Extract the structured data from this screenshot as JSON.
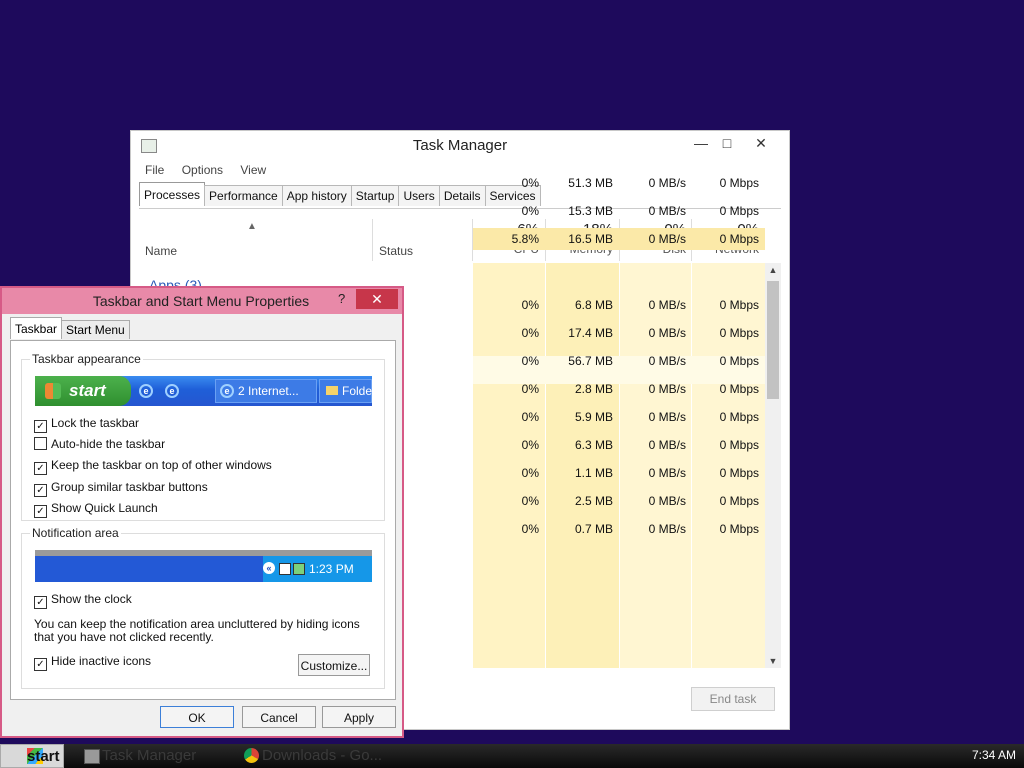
{
  "task_manager": {
    "title": "Task Manager",
    "menu": [
      "File",
      "Options",
      "View"
    ],
    "tabs": [
      "Processes",
      "Performance",
      "App history",
      "Startup",
      "Users",
      "Details",
      "Services"
    ],
    "active_tab": "Processes",
    "columns": {
      "name": "Name",
      "status": "Status",
      "cpu": {
        "pct": "6%",
        "label": "CPU"
      },
      "memory": {
        "pct": "18%",
        "label": "Memory"
      },
      "disk": {
        "pct": "0%",
        "label": "Disk"
      },
      "network": {
        "pct": "0%",
        "label": "Network"
      }
    },
    "group_label": "Apps (3)",
    "rows": [
      {
        "cpu": "0%",
        "memory": "51.3 MB",
        "disk": "0 MB/s",
        "network": "0 Mbps"
      },
      {
        "cpu": "0%",
        "memory": "15.3 MB",
        "disk": "0 MB/s",
        "network": "0 Mbps"
      },
      {
        "cpu": "5.8%",
        "memory": "16.5 MB",
        "disk": "0 MB/s",
        "network": "0 Mbps"
      },
      {
        "cpu": "",
        "memory": "",
        "disk": "",
        "network": ""
      },
      {
        "cpu": "0%",
        "memory": "6.8 MB",
        "disk": "0 MB/s",
        "network": "0 Mbps"
      },
      {
        "cpu": "0%",
        "memory": "17.4 MB",
        "disk": "0 MB/s",
        "network": "0 Mbps"
      },
      {
        "cpu": "0%",
        "memory": "56.7 MB",
        "disk": "0 MB/s",
        "network": "0 Mbps"
      },
      {
        "cpu": "0%",
        "memory": "2.8 MB",
        "disk": "0 MB/s",
        "network": "0 Mbps"
      },
      {
        "cpu": "0%",
        "memory": "5.9 MB",
        "disk": "0 MB/s",
        "network": "0 Mbps"
      },
      {
        "cpu": "0%",
        "memory": "6.3 MB",
        "disk": "0 MB/s",
        "network": "0 Mbps"
      },
      {
        "cpu": "0%",
        "memory": "1.1 MB",
        "disk": "0 MB/s",
        "network": "0 Mbps"
      },
      {
        "cpu": "0%",
        "memory": "2.5 MB",
        "disk": "0 MB/s",
        "network": "0 Mbps"
      },
      {
        "cpu": "0%",
        "memory": "0.7 MB",
        "disk": "0 MB/s",
        "network": "0 Mbps"
      }
    ],
    "end_task_label": "End task",
    "colors": {
      "cpu_highlight": "#fcefb4",
      "light_yellow": "#fff7d6"
    }
  },
  "properties": {
    "title": "Taskbar and Start Menu Properties",
    "help": "?",
    "tabs": [
      "Taskbar",
      "Start Menu"
    ],
    "appearance_title": "Taskbar appearance",
    "xp_preview": {
      "start": "start",
      "window_button": "2 Internet...",
      "folder_button": "Folde"
    },
    "options": [
      {
        "label": "Lock the taskbar",
        "checked": true
      },
      {
        "label": "Auto-hide the taskbar",
        "checked": false
      },
      {
        "label": "Keep the taskbar on top of other windows",
        "checked": true
      },
      {
        "label": "Group similar taskbar buttons",
        "checked": true
      },
      {
        "label": "Show Quick Launch",
        "checked": true
      }
    ],
    "notification_title": "Notification area",
    "tray_time": "1:23 PM",
    "show_clock": {
      "label": "Show the clock",
      "checked": true
    },
    "notification_text": "You can keep the notification area uncluttered by hiding icons that you have not clicked recently.",
    "hide_inactive": {
      "label": "Hide inactive icons",
      "checked": true
    },
    "customize_label": "Customize...",
    "ok_label": "OK",
    "cancel_label": "Cancel",
    "apply_label": "Apply"
  },
  "taskbar": {
    "start_label": "start",
    "items": [
      "Task Manager",
      "Downloads - Go..."
    ],
    "clock": "7:34 AM"
  }
}
